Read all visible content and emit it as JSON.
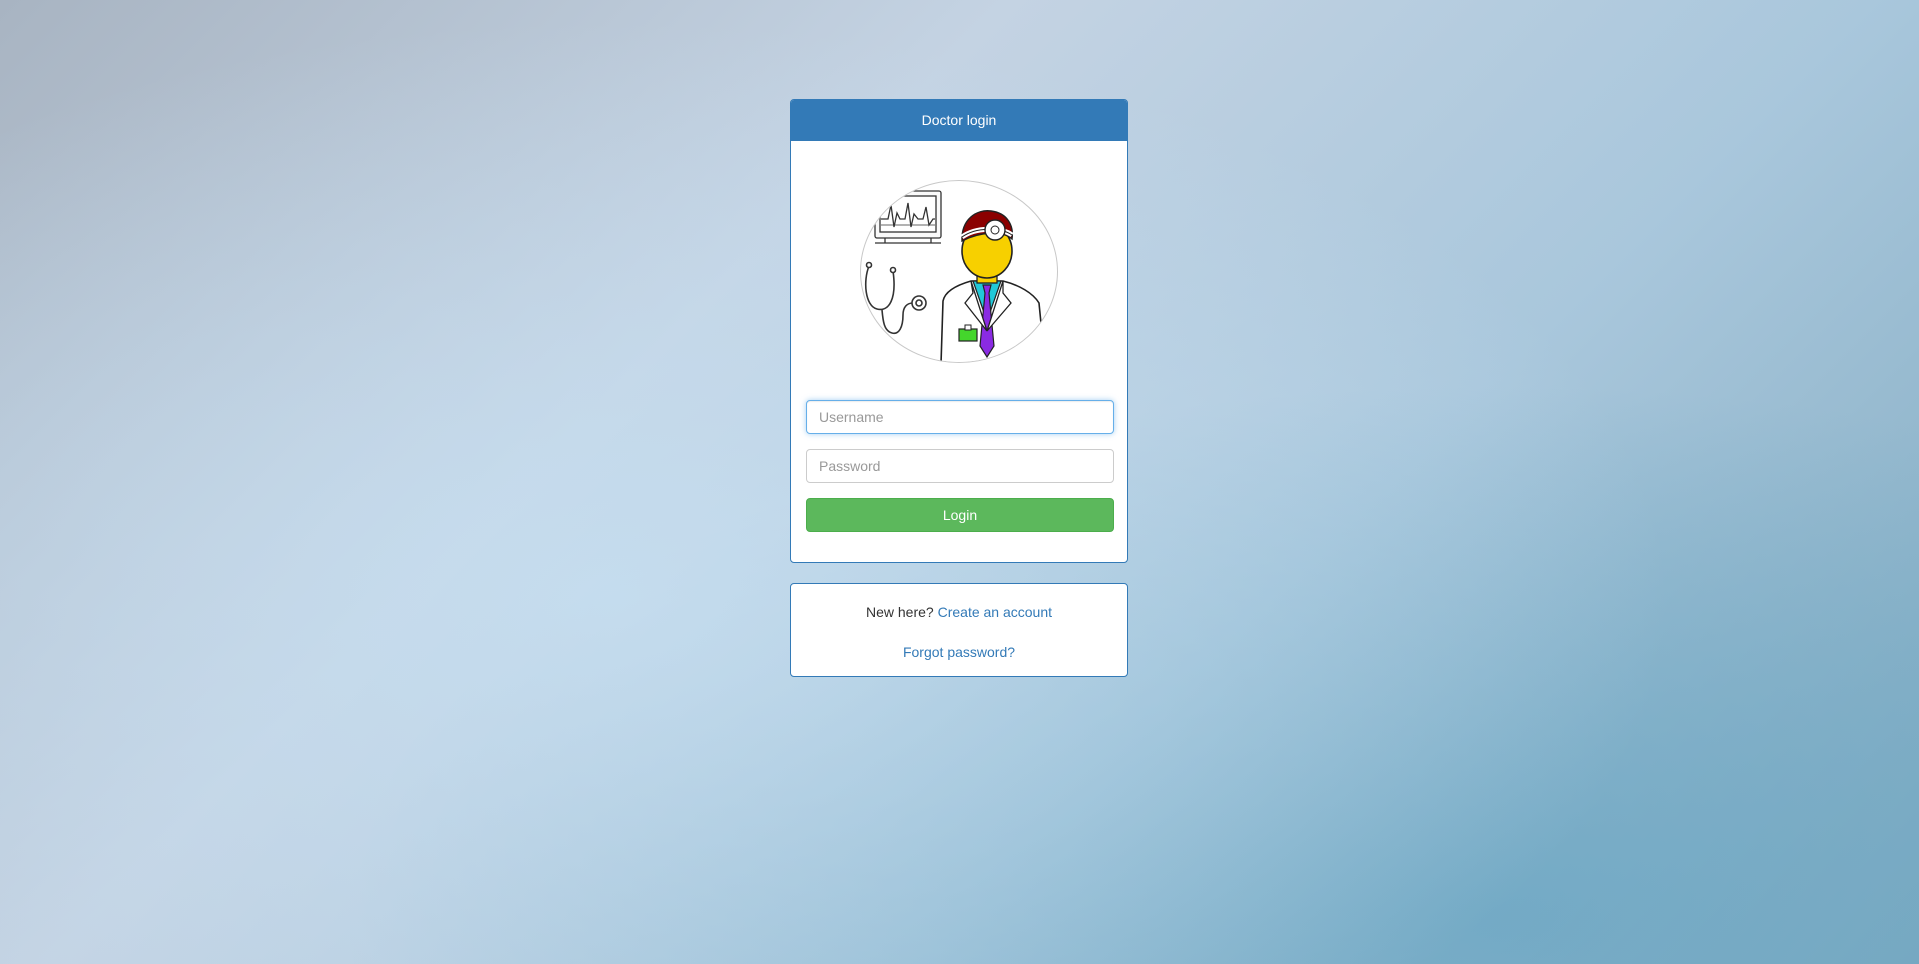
{
  "login_panel": {
    "title": "Doctor login",
    "avatar_icon": "doctor-illustration",
    "username_placeholder": "Username",
    "password_placeholder": "Password",
    "login_label": "Login"
  },
  "links_panel": {
    "new_here_text": "New here?",
    "create_account_label": "Create an account",
    "forgot_password_label": "Forgot password?"
  },
  "colors": {
    "primary": "#337ab7",
    "success": "#5cb85c",
    "focus": "#66afe9"
  }
}
